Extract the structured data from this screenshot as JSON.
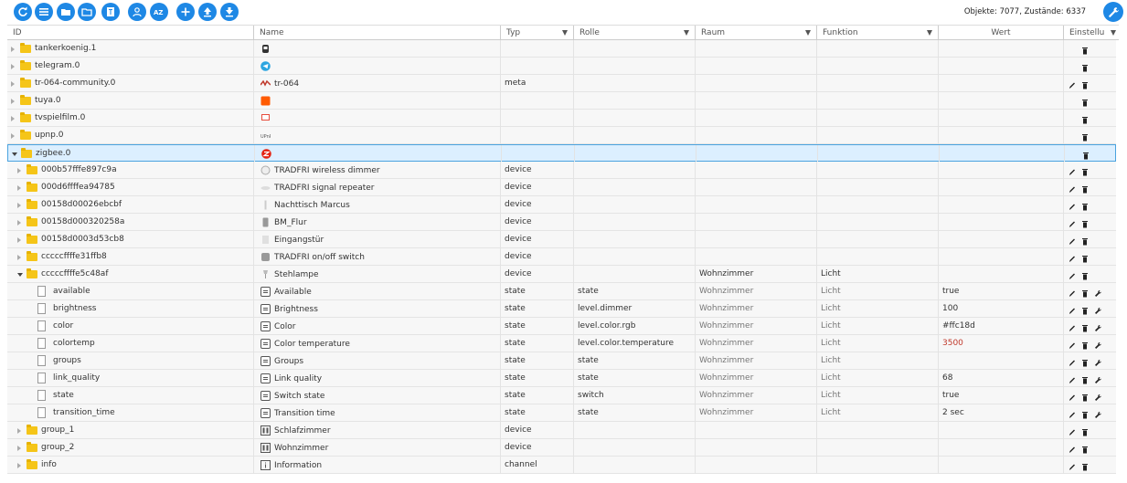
{
  "toolbar": {
    "buttons": [
      "refresh-icon",
      "list-icon",
      "folder-open-icon",
      "folder-icon",
      "document-icon",
      "users-icon",
      "sort-az-icon",
      "add-icon",
      "upload-icon",
      "download-icon"
    ],
    "objects_label": "Objekte: 7077, Zustände: 6337",
    "accent": "#1e88e5"
  },
  "header": {
    "id": "ID",
    "name": "Name",
    "typ": "Typ",
    "rolle": "Rolle",
    "raum": "Raum",
    "funktion": "Funktion",
    "wert": "Wert",
    "einstell": "Einstellu"
  },
  "rows": [
    {
      "id": "tankerkoenig.1",
      "name": "",
      "typ": "",
      "rolle": "",
      "raum": "",
      "funktion": "",
      "wert": "",
      "level": 0,
      "kind": "folder",
      "state": "closed",
      "icon": "tankerkoenig-icon",
      "actions": [
        "trash"
      ]
    },
    {
      "id": "telegram.0",
      "name": "",
      "typ": "",
      "rolle": "",
      "raum": "",
      "funktion": "",
      "wert": "",
      "level": 0,
      "kind": "folder",
      "state": "closed",
      "icon": "telegram-icon",
      "actions": [
        "trash"
      ]
    },
    {
      "id": "tr-064-community.0",
      "name": "tr-064",
      "typ": "meta",
      "rolle": "",
      "raum": "",
      "funktion": "",
      "wert": "",
      "level": 0,
      "kind": "folder",
      "state": "closed",
      "icon": "tr064-icon",
      "actions": [
        "edit",
        "trash"
      ]
    },
    {
      "id": "tuya.0",
      "name": "",
      "typ": "",
      "rolle": "",
      "raum": "",
      "funktion": "",
      "wert": "",
      "level": 0,
      "kind": "folder",
      "state": "closed",
      "icon": "tuya-icon",
      "actions": [
        "trash"
      ]
    },
    {
      "id": "tvspielfilm.0",
      "name": "",
      "typ": "",
      "rolle": "",
      "raum": "",
      "funktion": "",
      "wert": "",
      "level": 0,
      "kind": "folder",
      "state": "closed",
      "icon": "tvspielfilm-icon",
      "actions": [
        "trash"
      ]
    },
    {
      "id": "upnp.0",
      "name": "",
      "typ": "",
      "rolle": "",
      "raum": "",
      "funktion": "",
      "wert": "",
      "level": 0,
      "kind": "folder",
      "state": "closed",
      "icon": "upnp-icon",
      "actions": [
        "trash"
      ]
    },
    {
      "id": "zigbee.0",
      "name": "",
      "typ": "",
      "rolle": "",
      "raum": "",
      "funktion": "",
      "wert": "",
      "level": 0,
      "kind": "folder",
      "state": "open",
      "icon": "zigbee-icon",
      "actions": [
        "trash"
      ],
      "selected": true
    },
    {
      "id": "000b57fffe897c9a",
      "name": "TRADFRI wireless dimmer",
      "typ": "device",
      "rolle": "",
      "raum": "",
      "funktion": "",
      "wert": "",
      "level": 1,
      "kind": "folder",
      "state": "closed",
      "icon": "dimmer-icon",
      "actions": [
        "edit",
        "trash"
      ]
    },
    {
      "id": "000d6ffffea94785",
      "name": "TRADFRI signal repeater",
      "typ": "device",
      "rolle": "",
      "raum": "",
      "funktion": "",
      "wert": "",
      "level": 1,
      "kind": "folder",
      "state": "closed",
      "icon": "repeater-icon",
      "actions": [
        "edit",
        "trash"
      ]
    },
    {
      "id": "00158d00026ebcbf",
      "name": "Nachttisch Marcus",
      "typ": "device",
      "rolle": "",
      "raum": "",
      "funktion": "",
      "wert": "",
      "level": 1,
      "kind": "folder",
      "state": "closed",
      "icon": "sensor-icon",
      "actions": [
        "edit",
        "trash"
      ]
    },
    {
      "id": "00158d000320258a",
      "name": "BM_Flur",
      "typ": "device",
      "rolle": "",
      "raum": "",
      "funktion": "",
      "wert": "",
      "level": 1,
      "kind": "folder",
      "state": "closed",
      "icon": "motion-sensor-icon",
      "actions": [
        "edit",
        "trash"
      ]
    },
    {
      "id": "00158d0003d53cb8",
      "name": "Eingangstür",
      "typ": "device",
      "rolle": "",
      "raum": "",
      "funktion": "",
      "wert": "",
      "level": 1,
      "kind": "folder",
      "state": "closed",
      "icon": "door-sensor-icon",
      "actions": [
        "edit",
        "trash"
      ]
    },
    {
      "id": "cccccffffe31ffb8",
      "name": "TRADFRI on/off switch",
      "typ": "device",
      "rolle": "",
      "raum": "",
      "funktion": "",
      "wert": "",
      "level": 1,
      "kind": "folder",
      "state": "closed",
      "icon": "switch-icon",
      "actions": [
        "edit",
        "trash"
      ]
    },
    {
      "id": "cccccffffe5c48af",
      "name": "Stehlampe",
      "typ": "device",
      "rolle": "",
      "raum": "Wohnzimmer",
      "funktion": "Licht",
      "wert": "",
      "level": 1,
      "kind": "folder",
      "state": "open",
      "icon": "lamp-icon",
      "actions": [
        "edit",
        "trash"
      ],
      "rf_dark": true
    },
    {
      "id": "available",
      "name": "Available",
      "typ": "state",
      "rolle": "state",
      "raum": "Wohnzimmer",
      "funktion": "Licht",
      "wert": "true",
      "level": 2,
      "kind": "doc",
      "icon": "state-icon",
      "actions": [
        "edit",
        "trash",
        "wrench"
      ]
    },
    {
      "id": "brightness",
      "name": "Brightness",
      "typ": "state",
      "rolle": "level.dimmer",
      "raum": "Wohnzimmer",
      "funktion": "Licht",
      "wert": "100",
      "level": 2,
      "kind": "doc",
      "icon": "state-icon",
      "actions": [
        "edit",
        "trash",
        "wrench"
      ]
    },
    {
      "id": "color",
      "name": "Color",
      "typ": "state",
      "rolle": "level.color.rgb",
      "raum": "Wohnzimmer",
      "funktion": "Licht",
      "wert": "#ffc18d",
      "level": 2,
      "kind": "doc",
      "icon": "state-icon",
      "actions": [
        "edit",
        "trash",
        "wrench"
      ]
    },
    {
      "id": "colortemp",
      "name": "Color temperature",
      "typ": "state",
      "rolle": "level.color.temperature",
      "raum": "Wohnzimmer",
      "funktion": "Licht",
      "wert": "3500",
      "level": 2,
      "kind": "doc",
      "icon": "state-icon",
      "actions": [
        "edit",
        "trash",
        "wrench"
      ],
      "wert_red": true
    },
    {
      "id": "groups",
      "name": "Groups",
      "typ": "state",
      "rolle": "state",
      "raum": "Wohnzimmer",
      "funktion": "Licht",
      "wert": "",
      "level": 2,
      "kind": "doc",
      "icon": "state-icon",
      "actions": [
        "edit",
        "trash",
        "wrench"
      ]
    },
    {
      "id": "link_quality",
      "name": "Link quality",
      "typ": "state",
      "rolle": "state",
      "raum": "Wohnzimmer",
      "funktion": "Licht",
      "wert": "68",
      "level": 2,
      "kind": "doc",
      "icon": "state-icon",
      "actions": [
        "edit",
        "trash",
        "wrench"
      ]
    },
    {
      "id": "state",
      "name": "Switch state",
      "typ": "state",
      "rolle": "switch",
      "raum": "Wohnzimmer",
      "funktion": "Licht",
      "wert": "true",
      "level": 2,
      "kind": "doc",
      "icon": "state-icon",
      "actions": [
        "edit",
        "trash",
        "wrench"
      ]
    },
    {
      "id": "transition_time",
      "name": "Transition time",
      "typ": "state",
      "rolle": "state",
      "raum": "Wohnzimmer",
      "funktion": "Licht",
      "wert": "2 sec",
      "level": 2,
      "kind": "doc",
      "icon": "state-icon",
      "actions": [
        "edit",
        "trash",
        "wrench"
      ]
    },
    {
      "id": "group_1",
      "name": "Schlafzimmer",
      "typ": "device",
      "rolle": "",
      "raum": "",
      "funktion": "",
      "wert": "",
      "level": 1,
      "kind": "folder",
      "state": "closed",
      "icon": "group-icon",
      "actions": [
        "edit",
        "trash"
      ]
    },
    {
      "id": "group_2",
      "name": "Wohnzimmer",
      "typ": "device",
      "rolle": "",
      "raum": "",
      "funktion": "",
      "wert": "",
      "level": 1,
      "kind": "folder",
      "state": "closed",
      "icon": "group-icon",
      "actions": [
        "edit",
        "trash"
      ]
    },
    {
      "id": "info",
      "name": "Information",
      "typ": "channel",
      "rolle": "",
      "raum": "",
      "funktion": "",
      "wert": "",
      "level": 1,
      "kind": "folder",
      "state": "closed",
      "icon": "info-icon",
      "actions": [
        "edit",
        "trash"
      ]
    }
  ]
}
